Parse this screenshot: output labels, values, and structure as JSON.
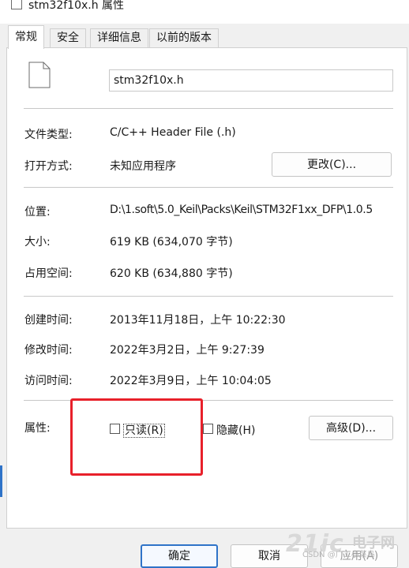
{
  "window": {
    "title": "stm32f10x.h 属性"
  },
  "tabs": [
    {
      "label": "常规",
      "active": true
    },
    {
      "label": "安全",
      "active": false
    },
    {
      "label": "详细信息",
      "active": false
    },
    {
      "label": "以前的版本",
      "active": false
    }
  ],
  "file": {
    "name": "stm32f10x.h",
    "icon": "file-icon"
  },
  "info": {
    "type_label": "文件类型:",
    "type_value": "C/C++ Header File (.h)",
    "open_label": "打开方式:",
    "open_value": "未知应用程序",
    "change_button": "更改(C)...",
    "location_label": "位置:",
    "location_value": "D:\\1.soft\\5.0_Keil\\Packs\\Keil\\STM32F1xx_DFP\\1.0.5",
    "size_label": "大小:",
    "size_value": "619 KB (634,070 字节)",
    "disk_label": "占用空间:",
    "disk_value": "620 KB (634,880 字节)",
    "created_label": "创建时间:",
    "created_value": "2013年11月18日，上午 10:22:30",
    "modified_label": "修改时间:",
    "modified_value": "2022年3月2日，上午 9:27:39",
    "accessed_label": "访问时间:",
    "accessed_value": "2022年3月9日，上午 10:04:05"
  },
  "attributes": {
    "label": "属性:",
    "readonly_label": "只读(R)",
    "readonly_checked": false,
    "hidden_label": "隐藏(H)",
    "hidden_checked": false,
    "advanced_button": "高级(D)..."
  },
  "footer": {
    "ok_button": "确定",
    "cancel_button": "取消",
    "apply_button": "应用(A)"
  },
  "watermark": {
    "logo": "21ic",
    "brand": "电子网",
    "text": "CSDN @广工小菜鸟"
  },
  "colors": {
    "highlight": "#e8202a",
    "accent": "#2f73c8"
  }
}
